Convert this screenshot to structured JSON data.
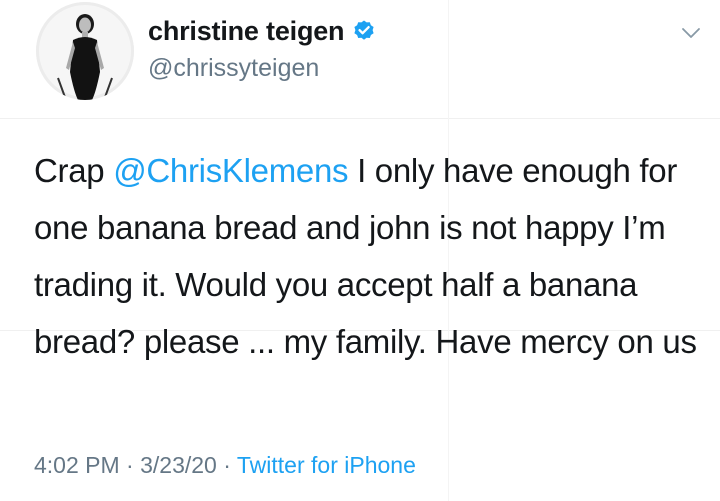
{
  "user": {
    "display_name": "christine teigen",
    "handle": "@chrissyteigen",
    "verified": true
  },
  "tweet": {
    "text_before": "Crap ",
    "mention": "@ChrisKlemens",
    "text_after": " I only have enough for one banana bread and john is not happy I’m trading it. Would you accept half a banana bread? please ... my family. Have mercy on us"
  },
  "meta": {
    "time": "4:02 PM",
    "separator_1": " · ",
    "date": "3/23/20",
    "separator_2": " · ",
    "source": "Twitter for iPhone"
  },
  "icons": {
    "verified": "verified-badge-icon",
    "menu": "chevron-down-icon"
  },
  "colors": {
    "link": "#1da1f2",
    "secondary": "#657786",
    "text": "#14171a"
  }
}
